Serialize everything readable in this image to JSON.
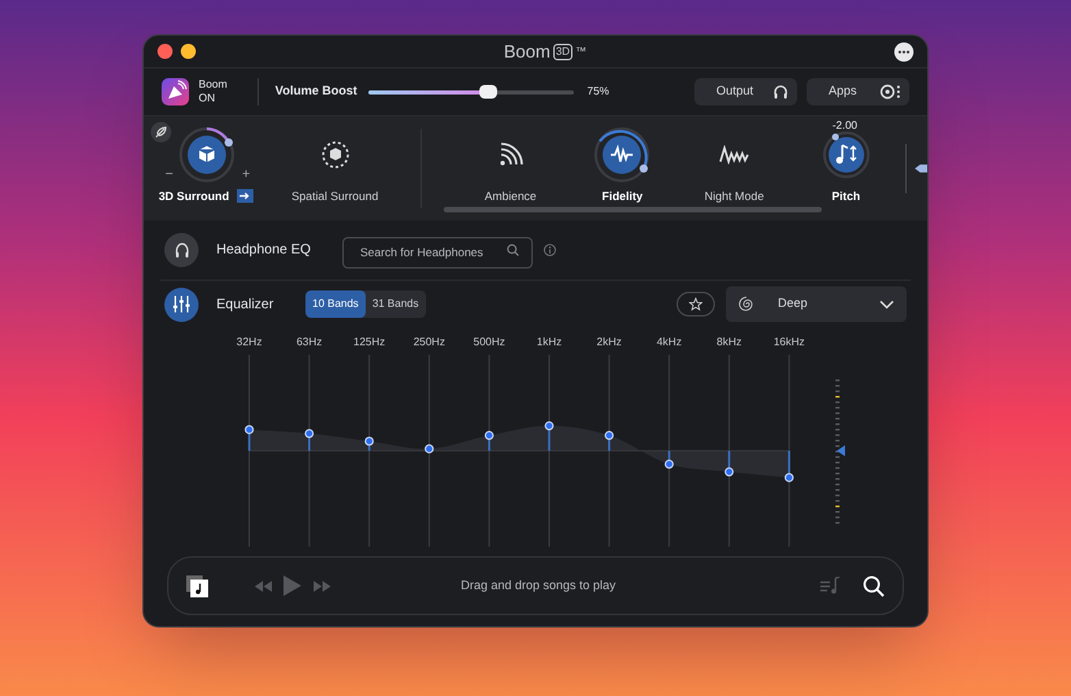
{
  "window": {
    "title": "Boom",
    "title_badge": "3D",
    "trademark": "™"
  },
  "toolbar": {
    "boom_label": "Boom",
    "boom_state": "ON",
    "volume_label": "Volume Boost",
    "volume": {
      "level": 0.58
    },
    "volume_reading": "75%",
    "buttons": [
      {
        "label": "Output",
        "kind": "headphones"
      },
      {
        "label": "Apps",
        "kind": "apps"
      }
    ]
  },
  "effects": [
    {
      "label": "3D Surround",
      "kind": "knob",
      "on": true,
      "minus": "−",
      "plus": "+"
    },
    {
      "label": "Spatial Surround",
      "kind": "spatial",
      "on": false
    },
    {
      "label": "Ambience",
      "kind": "ambience",
      "on": false
    },
    {
      "label": "Fidelity",
      "kind": "knob",
      "on": true
    },
    {
      "label": "Night Mode",
      "kind": "night",
      "on": false
    },
    {
      "label": "Pitch",
      "kind": "pitch",
      "on": true,
      "reading": "-2.00"
    }
  ],
  "headphone_eq": {
    "label": "Headphone EQ",
    "search": {
      "placeholder": "Search for Headphones"
    }
  },
  "equalizer": {
    "label": "Equalizer",
    "band_tabs": [
      {
        "label": "10 Bands",
        "selected": true
      },
      {
        "label": "31 Bands",
        "selected": false
      }
    ],
    "preset": "Deep"
  },
  "bands": [
    {
      "label": "32Hz",
      "level": 0.61
    },
    {
      "label": "63Hz",
      "level": 0.59
    },
    {
      "label": "125Hz",
      "level": 0.55
    },
    {
      "label": "250Hz",
      "level": 0.51
    },
    {
      "label": "500Hz",
      "level": 0.58
    },
    {
      "label": "1kHz",
      "level": 0.63
    },
    {
      "label": "2kHz",
      "level": 0.58
    },
    {
      "label": "4kHz",
      "level": 0.43
    },
    {
      "label": "8kHz",
      "level": 0.39
    },
    {
      "label": "16kHz",
      "level": 0.36
    }
  ],
  "player": {
    "message": "Drag and drop songs to play"
  }
}
